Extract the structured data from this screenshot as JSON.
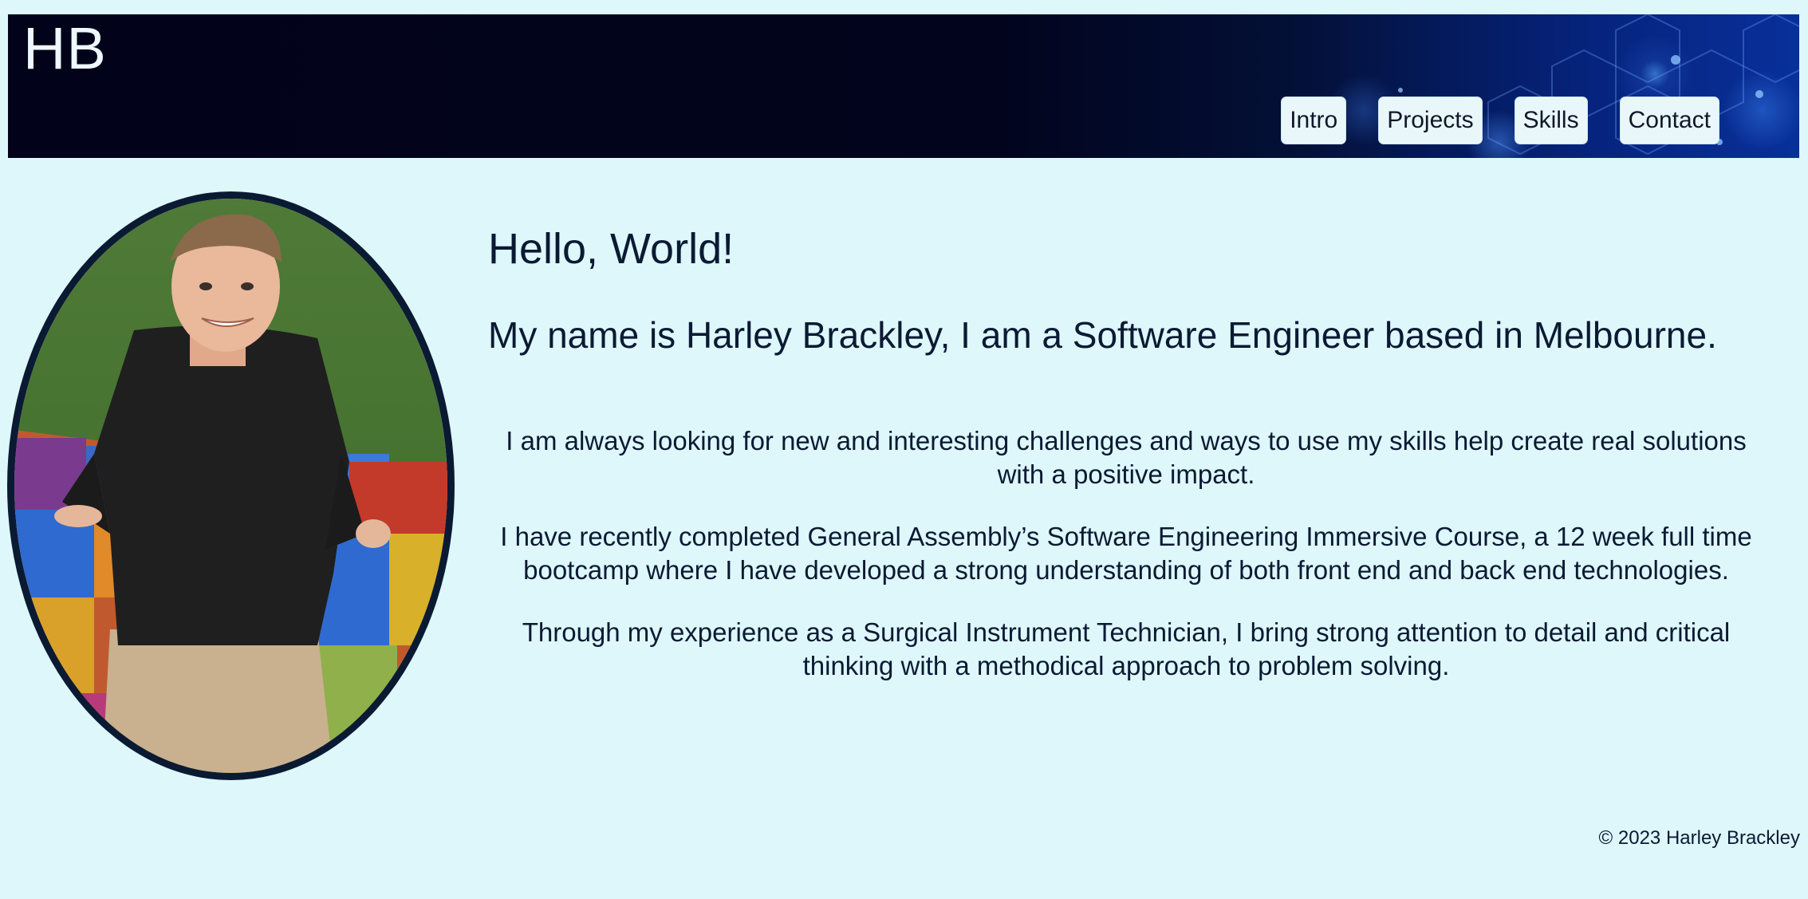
{
  "header": {
    "logo": "HB",
    "nav": [
      {
        "label": "Intro"
      },
      {
        "label": "Projects"
      },
      {
        "label": "Skills"
      },
      {
        "label": "Contact"
      }
    ]
  },
  "main": {
    "heading": "Hello, World!",
    "subheading": "My name is Harley Brackley, I am a Software Engineer based in Melbourne.",
    "paragraphs": [
      "I am always looking for new and interesting challenges and ways to use my skills help create real solutions with a positive impact.",
      "I have recently completed General Assembly’s Software Engineering Immersive Course, a 12 week full time bootcamp where I have developed a strong understanding of both front end and back end technologies.",
      "Through my experience as a Surgical Instrument Technician, I bring strong attention to detail and critical thinking with a methodical approach to problem solving."
    ]
  },
  "footer": {
    "copyright": "© 2023 Harley Brackley"
  },
  "colors": {
    "page_background": "#ddf7fb",
    "header_dark": "#02031a",
    "header_accent": "#08309a",
    "text": "#0b1a33",
    "nav_button": "#e9f7fb"
  }
}
